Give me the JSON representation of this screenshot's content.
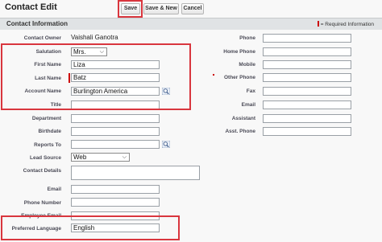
{
  "header": {
    "title": "Contact Edit",
    "buttons": {
      "save": "Save",
      "save_new": "Save & New",
      "cancel": "Cancel"
    }
  },
  "section": {
    "title": "Contact Information",
    "required_legend": "= Required Information"
  },
  "left_fields": {
    "contact_owner": {
      "label": "Contact Owner",
      "value": "Vaishali Ganotra"
    },
    "salutation": {
      "label": "Salutation",
      "value": "Mrs."
    },
    "first_name": {
      "label": "First Name",
      "value": "Liza"
    },
    "last_name": {
      "label": "Last Name",
      "value": "Batz"
    },
    "account_name": {
      "label": "Account Name",
      "value": "Burlington America"
    },
    "title": {
      "label": "Title",
      "value": ""
    },
    "department": {
      "label": "Department",
      "value": ""
    },
    "birthdate": {
      "label": "Birthdate",
      "value": ""
    },
    "reports_to": {
      "label": "Reports To",
      "value": ""
    },
    "lead_source": {
      "label": "Lead Source",
      "value": "Web"
    },
    "contact_details": {
      "label": "Contact Details",
      "value": ""
    },
    "email": {
      "label": "Email",
      "value": ""
    },
    "phone_number": {
      "label": "Phone Number",
      "value": ""
    },
    "employee_email": {
      "label": "Employee Email",
      "value": ""
    },
    "preferred_language": {
      "label": "Preferred Language",
      "value": "English"
    }
  },
  "right_fields": {
    "phone": {
      "label": "Phone"
    },
    "home_phone": {
      "label": "Home Phone"
    },
    "mobile": {
      "label": "Mobile"
    },
    "other_phone": {
      "label": "Other Phone"
    },
    "fax": {
      "label": "Fax"
    },
    "email": {
      "label": "Email"
    },
    "assistant": {
      "label": "Assistant"
    },
    "asst_phone": {
      "label": "Asst. Phone"
    }
  },
  "icons": {
    "lookup": "magnifier-lookup-icon",
    "dropdown": "chevron-down-icon"
  },
  "colors": {
    "required": "#cc0000",
    "highlight_box": "#d9363e",
    "section_bg": "#e0e3e5"
  }
}
